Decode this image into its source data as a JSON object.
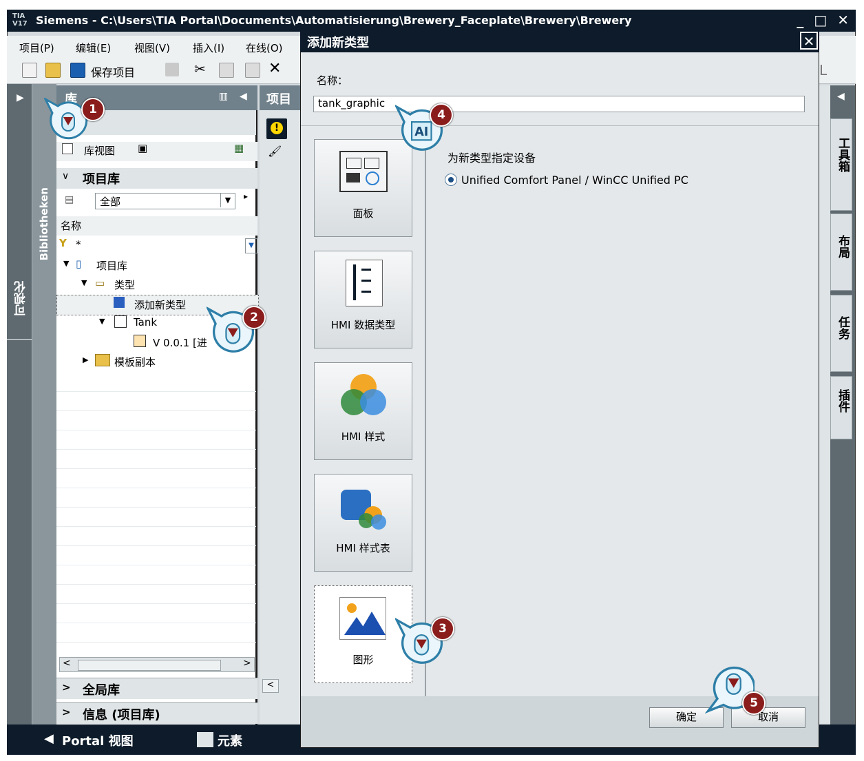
{
  "window": {
    "logo": "TIA V17",
    "title": "Siemens  -  C:\\Users\\TIA Portal\\Documents\\Automatisierung\\Brewery_Faceplate\\Brewery\\Brewery",
    "controls": "_ □ ✕"
  },
  "menu": [
    "项目(P)",
    "编辑(E)",
    "视图(V)",
    "插入(I)",
    "在线(O)"
  ],
  "toolbar": {
    "save_label": "保存项目",
    "right_letter": "L"
  },
  "left_strips": {
    "outer": "可视化",
    "inner": "Bibliotheken"
  },
  "library": {
    "header": "库",
    "view_tab": "库视图",
    "project_library": "项目库",
    "filter_value": "全部",
    "column_name": "名称",
    "filter_text": "*",
    "tree": {
      "root": "项目库",
      "types": "类型",
      "add_new_type": "添加新类型",
      "tank": "Tank",
      "version": "V 0.0.1 [进",
      "master_copies": "模板副本"
    },
    "global_library": "全局库",
    "info": "信息 (项目库)"
  },
  "middle": {
    "header": "项目"
  },
  "right_tabs": [
    "工具箱",
    "布局",
    "任务",
    "插件"
  ],
  "status": {
    "portal_view": "Portal 视图",
    "elements": "元素"
  },
  "dialog": {
    "title": "添加新类型",
    "close": "✕",
    "name_label": "名称：",
    "name_value": "tank_graphic",
    "tiles": [
      "面板",
      "HMI 数据类型",
      "HMI 样式",
      "HMI 样式表",
      "图形"
    ],
    "device_label": "为新类型指定设备",
    "device_option": "Unified Comfort Panel / WinCC Unified PC",
    "ok": "确定",
    "cancel": "取消"
  },
  "markers": [
    "1",
    "2",
    "3",
    "4",
    "5"
  ],
  "colors": {
    "titlebar": "#0d1b2a",
    "panel_header": "#70818b",
    "marker_badge": "#8b1c1c",
    "marker_ring": "#2e7fa8"
  }
}
